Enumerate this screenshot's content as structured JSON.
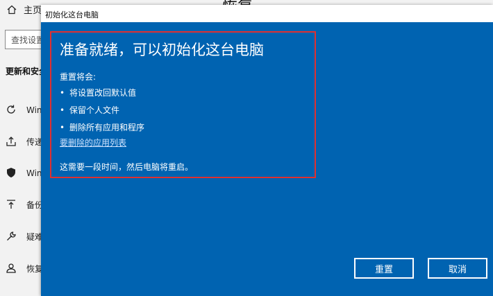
{
  "background": {
    "home_label": "主页",
    "search_placeholder": "查找设置",
    "section_title": "更新和安全",
    "top_right_title": "恢复",
    "items": [
      {
        "icon": "refresh-icon",
        "label": "Windows 更新"
      },
      {
        "icon": "upload-icon",
        "label": "传递优化"
      },
      {
        "icon": "shield-icon",
        "label": "Windows 安全中心"
      },
      {
        "icon": "backup-arrow-icon",
        "label": "备份"
      },
      {
        "icon": "wrench-icon",
        "label": "疑难解答"
      },
      {
        "icon": "recovery-icon",
        "label": "恢复"
      }
    ]
  },
  "dialog": {
    "title": "初始化这台电脑",
    "heading": "准备就绪，可以初始化这台电脑",
    "subheading": "重置将会:",
    "bullets": [
      "将设置改回默认值",
      "保留个人文件",
      "删除所有应用和程序"
    ],
    "app_list_link": "要删除的应用列表",
    "note": "这需要一段时间，然后电脑将重启。",
    "reset_button": "重置",
    "cancel_button": "取消",
    "colors": {
      "background": "#0063b1",
      "highlight_border": "#e03030"
    }
  }
}
